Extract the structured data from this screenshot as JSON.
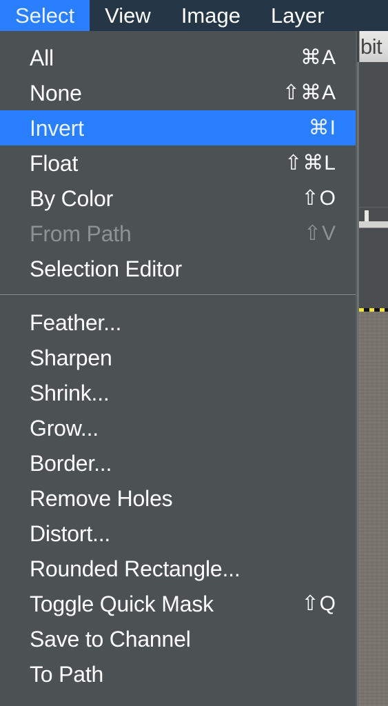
{
  "menubar": {
    "items": [
      {
        "label": "Select",
        "active": true
      },
      {
        "label": "View",
        "active": false
      },
      {
        "label": "Image",
        "active": false
      },
      {
        "label": "Layer",
        "active": false
      }
    ]
  },
  "canvas": {
    "tab_label": "bit"
  },
  "select_menu": {
    "title": "Select",
    "groups": [
      {
        "items": [
          {
            "label": "All",
            "shortcut": "⌘A",
            "selected": false,
            "disabled": false
          },
          {
            "label": "None",
            "shortcut": "⇧⌘A",
            "selected": false,
            "disabled": false
          },
          {
            "label": "Invert",
            "shortcut": "⌘I",
            "selected": true,
            "disabled": false
          },
          {
            "label": "Float",
            "shortcut": "⇧⌘L",
            "selected": false,
            "disabled": false
          },
          {
            "label": "By Color",
            "shortcut": "⇧O",
            "selected": false,
            "disabled": false
          },
          {
            "label": "From Path",
            "shortcut": "⇧V",
            "selected": false,
            "disabled": true
          },
          {
            "label": "Selection Editor",
            "shortcut": "",
            "selected": false,
            "disabled": false
          }
        ]
      },
      {
        "items": [
          {
            "label": "Feather...",
            "shortcut": "",
            "selected": false,
            "disabled": false
          },
          {
            "label": "Sharpen",
            "shortcut": "",
            "selected": false,
            "disabled": false
          },
          {
            "label": "Shrink...",
            "shortcut": "",
            "selected": false,
            "disabled": false
          },
          {
            "label": "Grow...",
            "shortcut": "",
            "selected": false,
            "disabled": false
          },
          {
            "label": "Border...",
            "shortcut": "",
            "selected": false,
            "disabled": false
          },
          {
            "label": "Remove Holes",
            "shortcut": "",
            "selected": false,
            "disabled": false
          },
          {
            "label": "Distort...",
            "shortcut": "",
            "selected": false,
            "disabled": false
          },
          {
            "label": "Rounded Rectangle...",
            "shortcut": "",
            "selected": false,
            "disabled": false
          },
          {
            "label": "Toggle Quick Mask",
            "shortcut": "⇧Q",
            "selected": false,
            "disabled": false
          },
          {
            "label": "Save to Channel",
            "shortcut": "",
            "selected": false,
            "disabled": false
          },
          {
            "label": "To Path",
            "shortcut": "",
            "selected": false,
            "disabled": false
          }
        ]
      }
    ]
  },
  "colors": {
    "menubar_background": "#253746",
    "menu_background": "#4c5153",
    "highlight": "#2a7fff",
    "text": "#ffffff",
    "disabled_text": "#8d9294",
    "separator": "#8f9496",
    "selection_ants_yellow": "#f2e33a",
    "selection_ants_black": "#121212"
  }
}
